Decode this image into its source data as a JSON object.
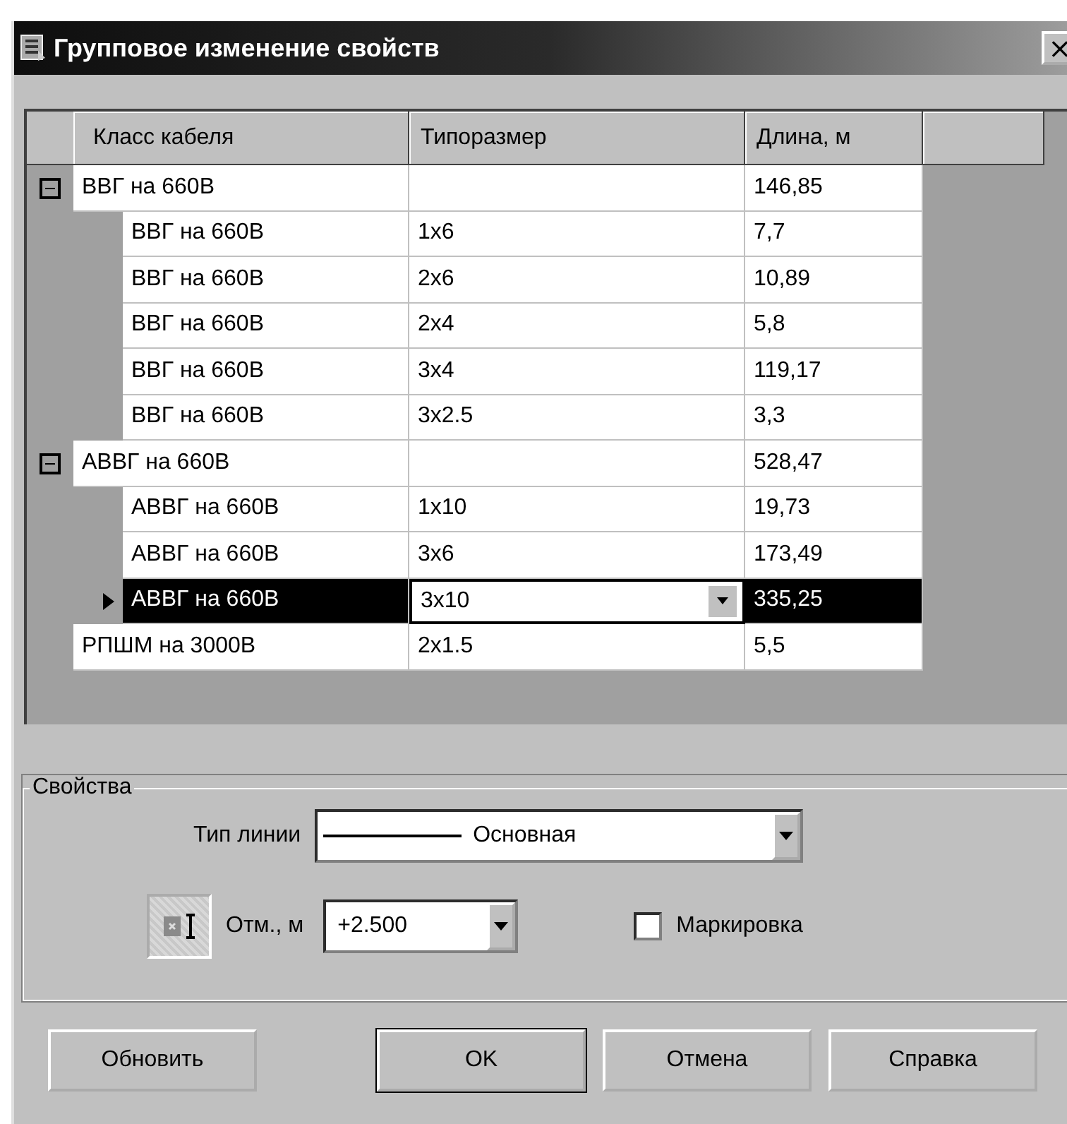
{
  "window": {
    "title": "Групповое изменение свойств",
    "close": "×"
  },
  "table": {
    "columns": [
      "Класс кабеля",
      "Типоразмер",
      "Длина, м"
    ],
    "rows": [
      {
        "class": "ВВГ на 660В",
        "size": "",
        "length": "146,85",
        "expanded": true,
        "selected": false,
        "children": [
          {
            "class": "ВВГ на 660В",
            "size": "1x6",
            "length": "7,7",
            "selected": false
          },
          {
            "class": "ВВГ на 660В",
            "size": "2x6",
            "length": "10,89",
            "selected": false
          },
          {
            "class": "ВВГ на 660В",
            "size": "2x4",
            "length": "5,8",
            "selected": false
          },
          {
            "class": "ВВГ на 660В",
            "size": "3x4",
            "length": "119,17",
            "selected": false
          },
          {
            "class": "ВВГ на 660В",
            "size": "3x2.5",
            "length": "3,3",
            "selected": false
          }
        ]
      },
      {
        "class": "АВВГ на 660В",
        "size": "",
        "length": "528,47",
        "expanded": true,
        "selected": false,
        "children": [
          {
            "class": "АВВГ на 660В",
            "size": "1x10",
            "length": "19,73",
            "selected": false
          },
          {
            "class": "АВВГ на 660В",
            "size": "3x6",
            "length": "173,49",
            "selected": false
          },
          {
            "class": "АВВГ на 660В",
            "size": "3x10",
            "length": "335,25",
            "selected": true
          }
        ]
      },
      {
        "class": "РПШМ на 3000В",
        "size": "2x1.5",
        "length": "5,5",
        "selected": false
      }
    ]
  },
  "properties": {
    "title": "Свойства",
    "line_type_label": "Тип линии",
    "line_type_value": "Основная",
    "elevation_label": "Отм., м",
    "elevation_value": "+2.500",
    "marking_label": "Маркировка",
    "marking_checked": false
  },
  "buttons": [
    {
      "label": "Обновить",
      "default": false
    },
    {
      "label": "OK",
      "default": true
    },
    {
      "label": "Отмена",
      "default": false
    },
    {
      "label": "Справка",
      "default": false
    }
  ]
}
